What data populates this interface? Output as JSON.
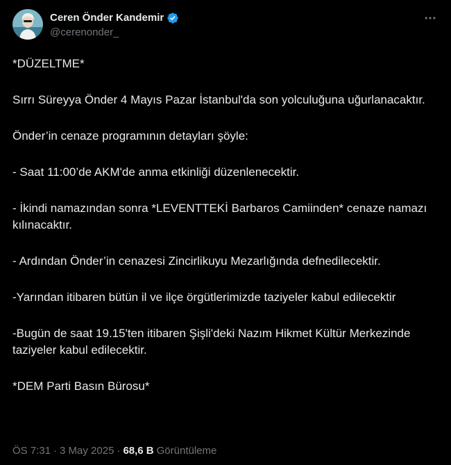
{
  "author": {
    "display_name": "Ceren Önder Kandemir",
    "handle": "@cerenonder_",
    "verified": true,
    "verified_color": "#1d9bf0"
  },
  "tweet": {
    "paragraphs": [
      "*DÜZELTME*",
      "Sırrı Süreyya Önder 4 Mayıs Pazar İstanbul'da son yolculuğuna uğurlanacaktır.",
      "Önder’in cenaze programının detayları şöyle:",
      "- Saat 11:00’de AKM'de anma etkinliği düzenlenecektir.",
      "- İkindi namazından sonra *LEVENTTEKİ Barbaros Camiinden* cenaze namazı kılınacaktır.",
      "- Ardından Önder’in cenazesi Zincirlikuyu Mezarlığında defnedilecektir.",
      "-Yarından itibaren bütün il ve ilçe örgütlerimizde taziyeler kabul edilecektir",
      "-Bugün de saat 19.15'ten itibaren Şişli'deki Nazım Hikmet Kültür Merkezinde taziyeler kabul edilecektir.",
      "*DEM Parti Basın Bürosu*"
    ]
  },
  "meta": {
    "time": "ÖS 7:31",
    "separator": "·",
    "date": "3 May 2025",
    "views_count": "68,6 B",
    "views_label": "Görüntüleme"
  },
  "icons": {
    "more": "more-horizontal-icon",
    "verified": "verified-badge-icon"
  },
  "colors": {
    "background": "#000000",
    "text_primary": "#e7e9ea",
    "text_secondary": "#71767b",
    "accent": "#1d9bf0"
  }
}
